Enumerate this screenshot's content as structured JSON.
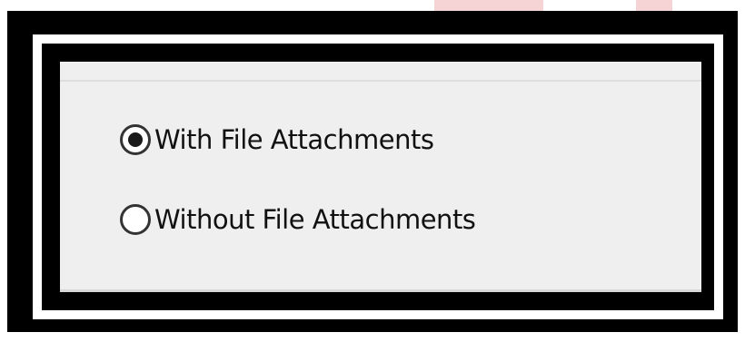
{
  "attachment_options": {
    "items": [
      {
        "label": "With File Attachments",
        "selected": true
      },
      {
        "label": "Without File Attachments",
        "selected": false
      }
    ]
  },
  "colors": {
    "frame": "#000000",
    "panel_bg": "#efefef",
    "radio_border": "#333333",
    "radio_dot": "#1a1a1a",
    "text": "#111111"
  }
}
